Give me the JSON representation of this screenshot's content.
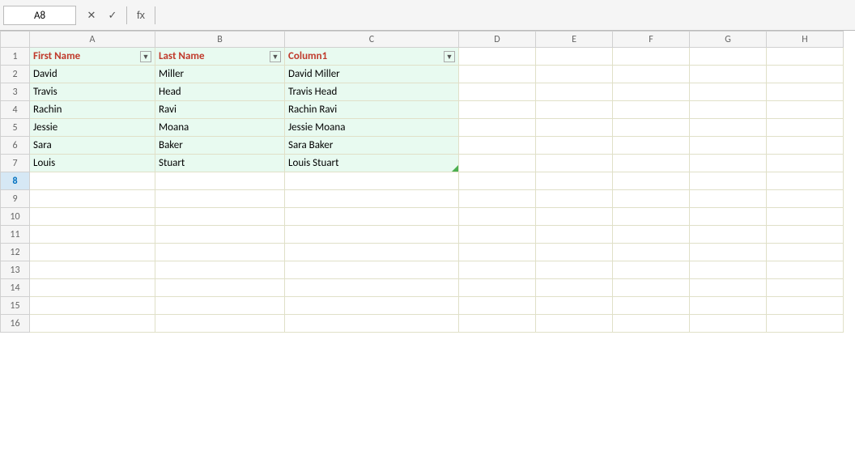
{
  "formulaBar": {
    "nameBox": "A8",
    "cancelBtn": "✕",
    "confirmBtn": "✓",
    "fxBtn": "fx",
    "formula": ""
  },
  "columns": {
    "rowHeader": "",
    "letters": [
      "A",
      "B",
      "C",
      "D",
      "E",
      "F",
      "G",
      "H"
    ]
  },
  "rows": [
    {
      "num": 1,
      "isHeader": true,
      "cells": [
        "First Name",
        "Last Name",
        "Column1",
        "",
        "",
        "",
        "",
        ""
      ]
    },
    {
      "num": 2,
      "cells": [
        "David",
        "Miller",
        "David Miller",
        "",
        "",
        "",
        "",
        ""
      ]
    },
    {
      "num": 3,
      "cells": [
        "Travis",
        "Head",
        "Travis Head",
        "",
        "",
        "",
        "",
        ""
      ]
    },
    {
      "num": 4,
      "cells": [
        "Rachin",
        "Ravi",
        "Rachin Ravi",
        "",
        "",
        "",
        "",
        ""
      ]
    },
    {
      "num": 5,
      "cells": [
        "Jessie",
        "Moana",
        "Jessie Moana",
        "",
        "",
        "",
        "",
        ""
      ]
    },
    {
      "num": 6,
      "cells": [
        "Sara",
        "Baker",
        "Sara Baker",
        "",
        "",
        "",
        "",
        ""
      ]
    },
    {
      "num": 7,
      "cells": [
        "Louis",
        "Stuart",
        "Louis Stuart",
        "",
        "",
        "",
        "",
        ""
      ]
    },
    {
      "num": 8,
      "cells": [
        "",
        "",
        "",
        "",
        "",
        "",
        "",
        ""
      ]
    },
    {
      "num": 9,
      "cells": [
        "",
        "",
        "",
        "",
        "",
        "",
        "",
        ""
      ]
    },
    {
      "num": 10,
      "cells": [
        "",
        "",
        "",
        "",
        "",
        "",
        "",
        ""
      ]
    },
    {
      "num": 11,
      "cells": [
        "",
        "",
        "",
        "",
        "",
        "",
        "",
        ""
      ]
    },
    {
      "num": 12,
      "cells": [
        "",
        "",
        "",
        "",
        "",
        "",
        "",
        ""
      ]
    },
    {
      "num": 13,
      "cells": [
        "",
        "",
        "",
        "",
        "",
        "",
        "",
        ""
      ]
    },
    {
      "num": 14,
      "cells": [
        "",
        "",
        "",
        "",
        "",
        "",
        "",
        ""
      ]
    },
    {
      "num": 15,
      "cells": [
        "",
        "",
        "",
        "",
        "",
        "",
        "",
        ""
      ]
    },
    {
      "num": 16,
      "cells": [
        "",
        "",
        "",
        "",
        "",
        "",
        "",
        ""
      ]
    }
  ]
}
